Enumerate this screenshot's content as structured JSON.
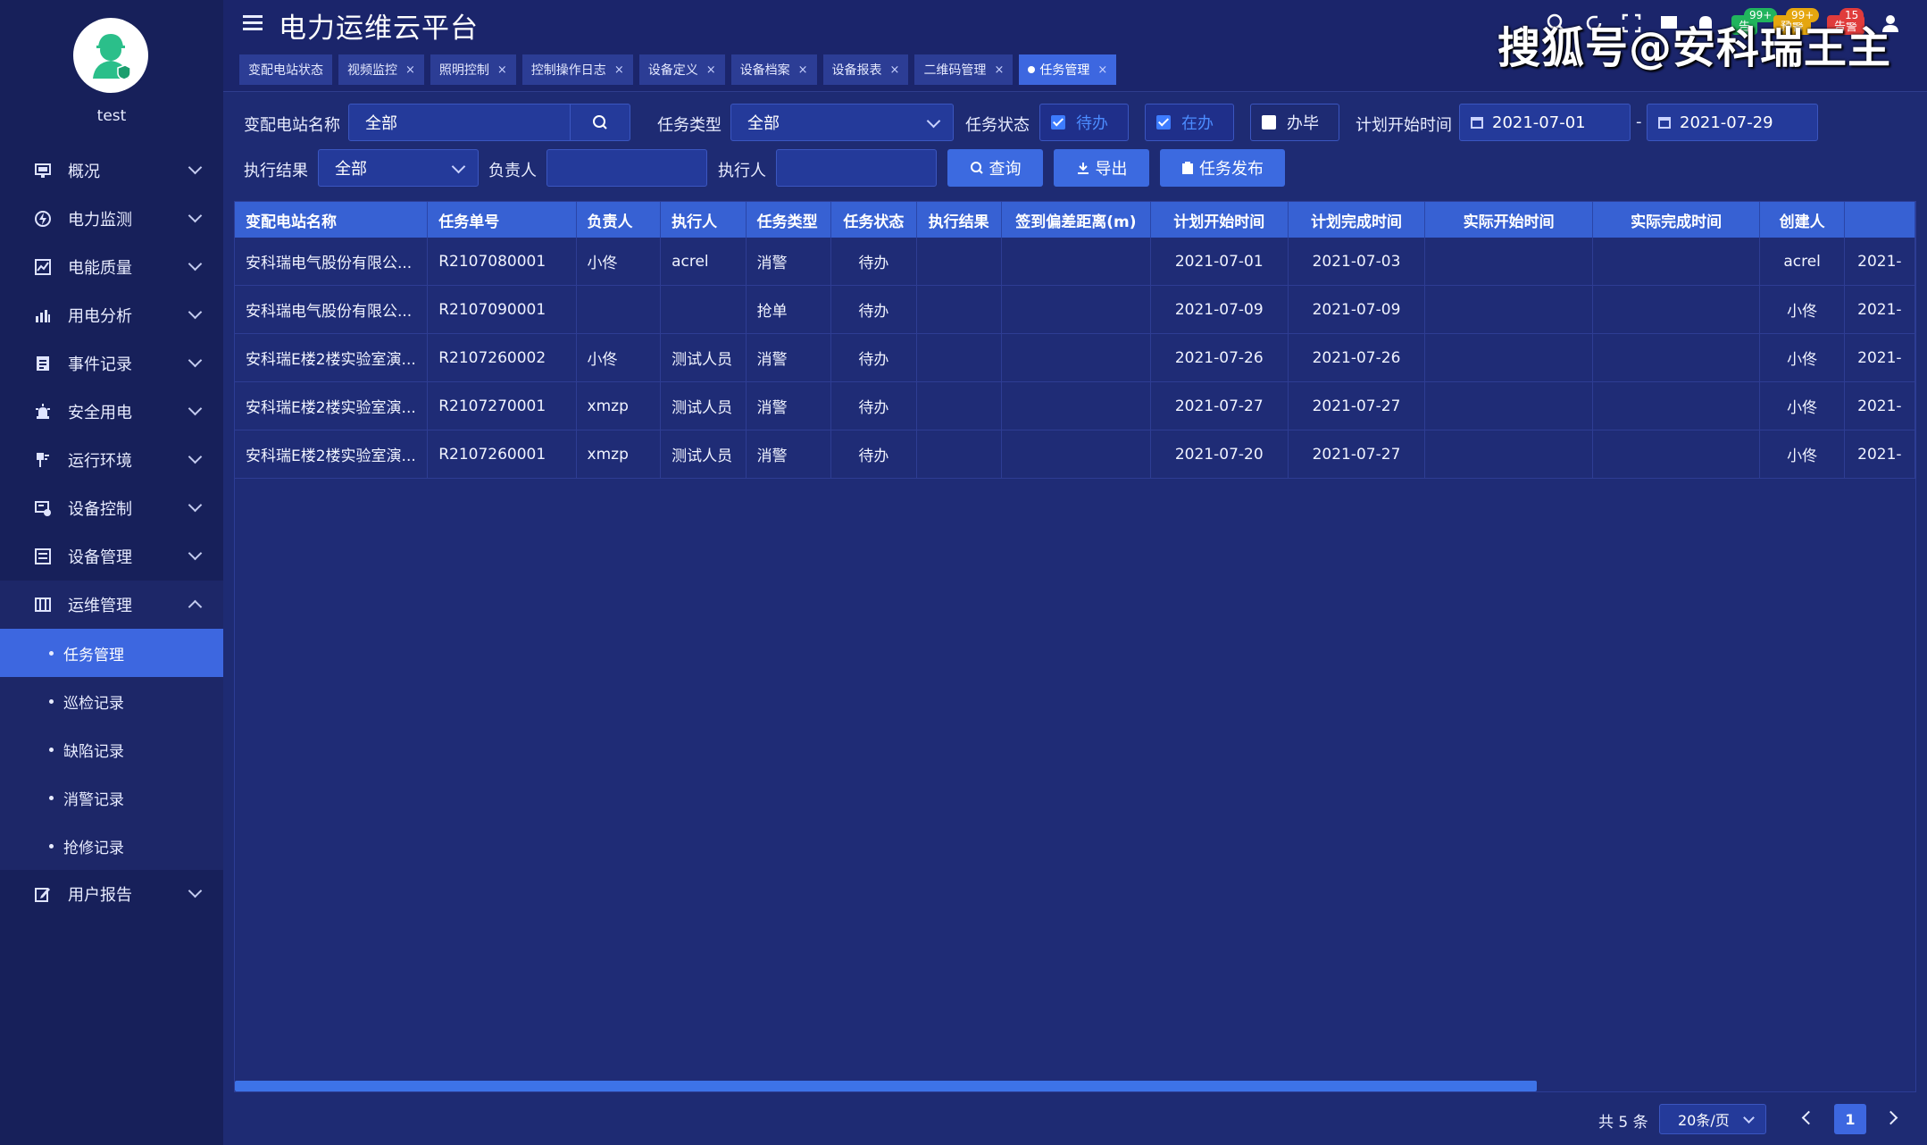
{
  "app": {
    "title": "电力运维云平台"
  },
  "user": {
    "name": "test"
  },
  "watermark": "搜狐号@安科瑞王主",
  "header": {
    "badges": {
      "green": "99+",
      "yellow": "99+",
      "red": "15"
    },
    "pills": {
      "green": "告",
      "yellow": "预警",
      "red": "告警"
    }
  },
  "tabs": [
    {
      "label": "变配电站状态"
    },
    {
      "label": "视频监控"
    },
    {
      "label": "照明控制"
    },
    {
      "label": "控制操作日志"
    },
    {
      "label": "设备定义"
    },
    {
      "label": "设备档案"
    },
    {
      "label": "设备报表"
    },
    {
      "label": "二维码管理"
    },
    {
      "label": "任务管理"
    }
  ],
  "sidebar": {
    "items": [
      {
        "label": "概况",
        "icon": "monitor-icon"
      },
      {
        "label": "电力监测",
        "icon": "power-monitor-icon"
      },
      {
        "label": "电能质量",
        "icon": "power-quality-icon"
      },
      {
        "label": "用电分析",
        "icon": "bar-chart-icon"
      },
      {
        "label": "事件记录",
        "icon": "event-log-icon"
      },
      {
        "label": "安全用电",
        "icon": "alarm-light-icon"
      },
      {
        "label": "运行环境",
        "icon": "environment-icon"
      },
      {
        "label": "设备控制",
        "icon": "device-control-icon"
      },
      {
        "label": "设备管理",
        "icon": "device-manage-icon"
      },
      {
        "label": "运维管理",
        "icon": "ops-manage-icon"
      },
      {
        "label": "用户报告",
        "icon": "edit-report-icon"
      }
    ],
    "sub_items": [
      {
        "label": "任务管理"
      },
      {
        "label": "巡检记录"
      },
      {
        "label": "缺陷记录"
      },
      {
        "label": "消警记录"
      },
      {
        "label": "抢修记录"
      }
    ]
  },
  "filters": {
    "station_label": "变配电站名称",
    "station_value": "全部",
    "task_type_label": "任务类型",
    "task_type_value": "全部",
    "task_status_label": "任务状态",
    "status_options": [
      {
        "label": "待办",
        "checked": true
      },
      {
        "label": "在办",
        "checked": true
      },
      {
        "label": "办毕",
        "checked": false
      }
    ],
    "plan_start_label": "计划开始时间",
    "date_from": "2021-07-01",
    "date_sep": "-",
    "date_to": "2021-07-29",
    "result_label": "执行结果",
    "result_value": "全部",
    "owner_label": "负责人",
    "owner_value": "",
    "executor_label": "执行人",
    "executor_value": ""
  },
  "buttons": {
    "query": "查询",
    "export": "导出",
    "publish": "任务发布"
  },
  "table": {
    "columns": [
      "变配电站名称",
      "任务单号",
      "负责人",
      "执行人",
      "任务类型",
      "任务状态",
      "执行结果",
      "签到偏差距离(m)",
      "计划开始时间",
      "计划完成时间",
      "实际开始时间",
      "实际完成时间",
      "创建人",
      ""
    ],
    "rows": [
      [
        "安科瑞电气股份有限公...",
        "R2107080001",
        "小佟",
        "acrel",
        "消警",
        "待办",
        "",
        "",
        "2021-07-01",
        "2021-07-03",
        "",
        "",
        "acrel",
        "2021-"
      ],
      [
        "安科瑞电气股份有限公...",
        "R2107090001",
        "",
        "",
        "抢单",
        "待办",
        "",
        "",
        "2021-07-09",
        "2021-07-09",
        "",
        "",
        "小佟",
        "2021-"
      ],
      [
        "安科瑞E楼2楼实验室演...",
        "R2107260002",
        "小佟",
        "测试人员",
        "消警",
        "待办",
        "",
        "",
        "2021-07-26",
        "2021-07-26",
        "",
        "",
        "小佟",
        "2021-"
      ],
      [
        "安科瑞E楼2楼实验室演...",
        "R2107270001",
        "xmzp",
        "测试人员",
        "消警",
        "待办",
        "",
        "",
        "2021-07-27",
        "2021-07-27",
        "",
        "",
        "小佟",
        "2021-"
      ],
      [
        "安科瑞E楼2楼实验室演...",
        "R2107260001",
        "xmzp",
        "测试人员",
        "消警",
        "待办",
        "",
        "",
        "2021-07-20",
        "2021-07-27",
        "",
        "",
        "小佟",
        "2021-"
      ]
    ]
  },
  "pagination": {
    "total": "共 5 条",
    "page_size": "20条/页",
    "current": "1"
  }
}
